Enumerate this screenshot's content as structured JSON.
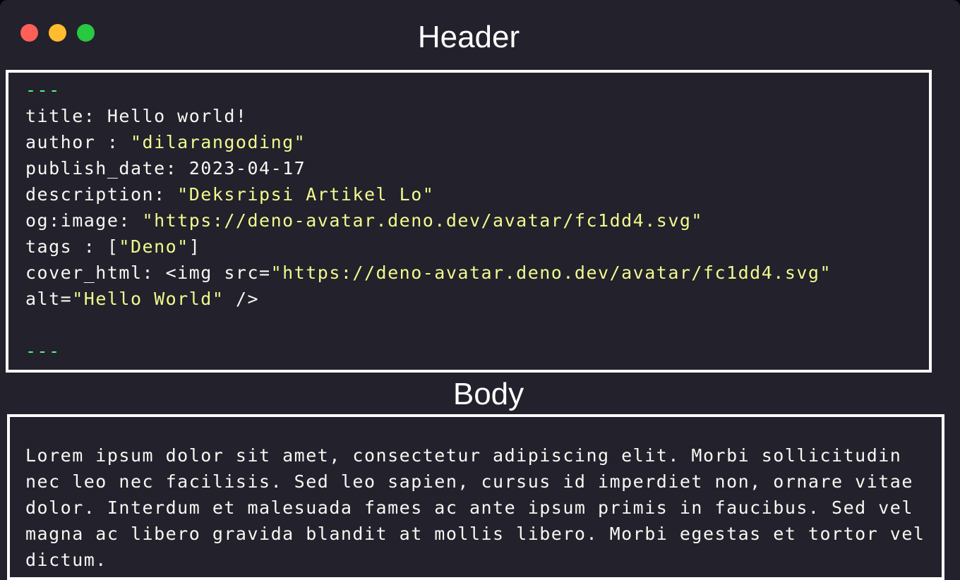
{
  "window": {
    "controls": [
      "close",
      "minimize",
      "maximize"
    ],
    "colors": {
      "background": "#22212c",
      "string": "#f1fa8c",
      "delimiter": "#50fa7b",
      "text": "#f8f8f2"
    }
  },
  "header": {
    "title": "Header",
    "delimiter": "---",
    "lines": [
      {
        "key": "title: ",
        "value": "Hello world!",
        "value_is_string": false
      },
      {
        "key": "author : ",
        "value": "\"dilarangoding\""
      },
      {
        "key": "publish_date: ",
        "value": "2023-04-17"
      },
      {
        "key": "description: ",
        "value": "\"Deksripsi Artikel Lo\""
      },
      {
        "key": "og:image: ",
        "value": "\"https://deno-avatar.deno.dev/avatar/fc1dd4.svg\""
      },
      {
        "key": "tags : [",
        "value": "\"Deno\"",
        "suffix": "]"
      },
      {
        "key": "cover_html: <img src=",
        "value": "\"https://deno-avatar.deno.dev/avatar/fc1dd4.svg\""
      },
      {
        "key": "alt=",
        "value": "\"Hello World\"",
        "suffix": " />"
      }
    ]
  },
  "body": {
    "title": "Body",
    "lines": [
      "Lorem ipsum dolor sit amet, consectetur adipiscing elit. Morbi sollicitudin",
      "nec leo nec facilisis. Sed leo sapien, cursus id imperdiet non, ornare vitae",
      "dolor. Interdum et malesuada fames ac ante ipsum primis in faucibus. Sed vel",
      "magna ac libero gravida blandit at mollis libero. Morbi egestas et tortor vel",
      "dictum."
    ]
  }
}
